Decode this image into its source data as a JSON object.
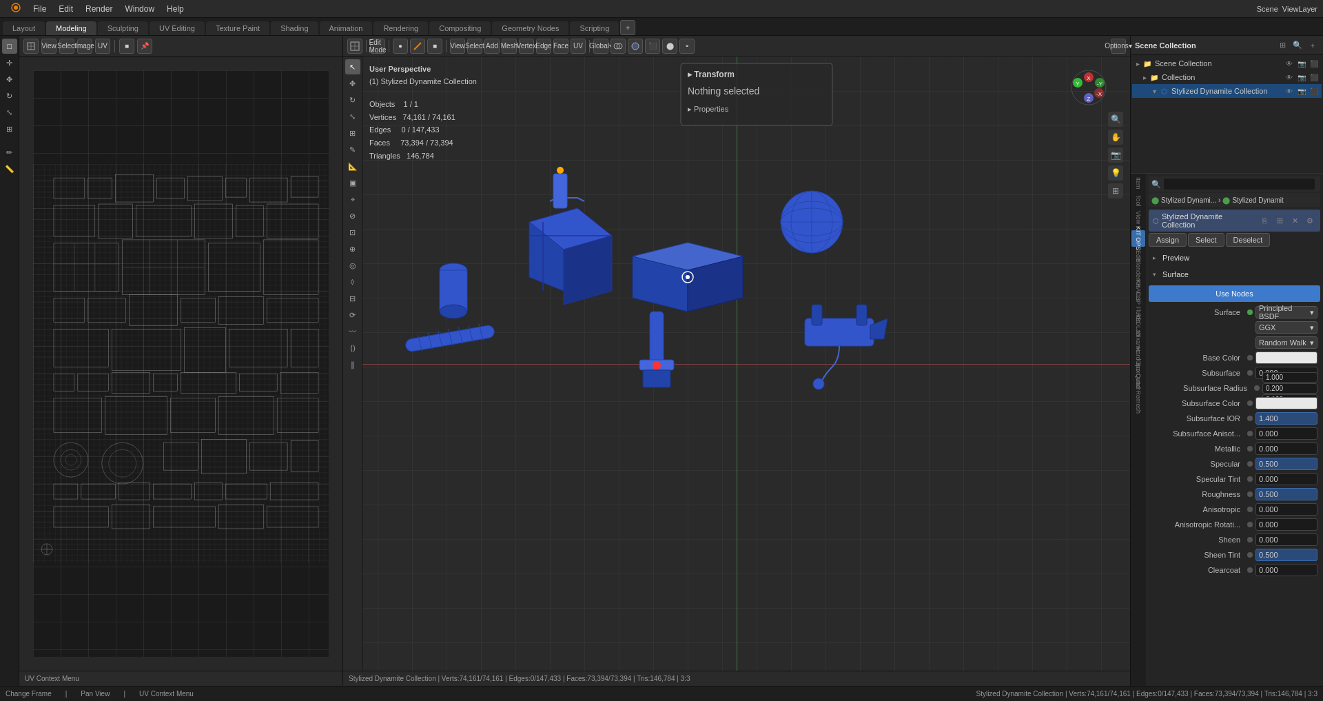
{
  "app": {
    "title": "Blender"
  },
  "top_menu": {
    "items": [
      "Blender",
      "File",
      "Edit",
      "Render",
      "Window",
      "Help"
    ],
    "right_items": [
      "Scene",
      "ViewLayer"
    ]
  },
  "workspace_tabs": {
    "tabs": [
      "Layout",
      "Modeling",
      "Sculpting",
      "UV Editing",
      "Texture Paint",
      "Shading",
      "Animation",
      "Rendering",
      "Compositing",
      "Geometry Nodes",
      "Scripting"
    ],
    "active": "Modeling"
  },
  "left_panel": {
    "view_label": "UV Editor",
    "toolbar_items": [
      "View",
      "Select",
      "Image",
      "UV"
    ],
    "bottom_label": "UV Context Menu"
  },
  "viewport": {
    "mode": "Edit Mode",
    "perspective": "User Perspective",
    "collection": "(1) Stylized Dynamite Collection",
    "objects": "1 / 1",
    "vertices": "74,161 / 74,161",
    "edges": "0 / 147,433",
    "faces": "73,394 / 73,394",
    "triangles": "146,784",
    "nothing_selected": "Nothing selected",
    "transform": "Transform",
    "properties": "Properties",
    "global": "Global",
    "options": "Options"
  },
  "right_panel": {
    "scene_collection_label": "Scene Collection",
    "collection_label": "Collection",
    "stylized_collection_label": "Stylized Dynamite Collection",
    "search_placeholder": "Search",
    "breadcrumb": {
      "part1": "Stylized Dynami...",
      "sep": "›",
      "part2": "Stylized Dynamit"
    },
    "material_section": {
      "name": "Stylized Dynamite Collection",
      "assign_label": "Assign",
      "select_label": "Select",
      "deselect_label": "Deselect",
      "preview_label": "Preview",
      "surface_label": "Surface",
      "use_nodes_label": "Use Nodes"
    },
    "properties": {
      "surface_label": "Surface",
      "surface_value": "Principled BSDF",
      "ggx_label": "GGX",
      "random_walk_label": "Random Walk",
      "base_color_label": "Base Color",
      "subsurface_label": "Subsurface",
      "subsurface_value": "0.000",
      "subsurface_radius_label": "Subsurface Radius",
      "subsurface_radius_values": [
        "1.000",
        "0.200",
        "0.100"
      ],
      "subsurface_color_label": "Subsurface Color",
      "subsurface_ior_label": "Subsurface IOR",
      "subsurface_ior_value": "1.400",
      "subsurface_aniso_label": "Subsurface Anisot...",
      "subsurface_aniso_value": "0.000",
      "metallic_label": "Metallic",
      "metallic_value": "0.000",
      "specular_label": "Specular",
      "specular_value": "0.500",
      "specular_tint_label": "Specular Tint",
      "specular_tint_value": "0.000",
      "roughness_label": "Roughness",
      "roughness_value": "0.500",
      "anisotropic_label": "Anisotropic",
      "anisotropic_value": "0.000",
      "anisotropic_rot_label": "Anisotropic Rotati...",
      "anisotropic_rot_value": "0.000",
      "sheen_label": "Sheen",
      "sheen_value": "0.000",
      "sheen_tint_label": "Sheen Tint",
      "sheen_tint_value": "0.500",
      "clearcoat_label": "Clearcoat",
      "clearcoat_value": "0.000"
    }
  },
  "status_bar": {
    "left": "Change Frame",
    "middle": "Pan View",
    "right": "UV Context Menu",
    "info": "Stylized Dynamite Collection | Verts:74,161/74,161 | Edges:0/147,433 | Faces:73,394/73,394 | Tris:146,784 | 3:3"
  },
  "vertical_tabs": [
    "Item",
    "Tool",
    "View",
    "KIT OPS",
    "Edit",
    "BlenderKit",
    "KHAOS",
    "FLIP Fluids",
    "RBDLab",
    "Mixamo",
    "HardOps",
    "BoxCutter",
    "Quad Remesh"
  ],
  "icons": {
    "arrow_right": "▶",
    "arrow_down": "▼",
    "eye": "👁",
    "camera": "📷",
    "render": "⬛",
    "collection": "📁",
    "mesh": "⬡",
    "material": "⬤",
    "search": "🔍",
    "add": "+",
    "close": "✕",
    "settings": "⚙",
    "link": "🔗",
    "dot": "•"
  }
}
